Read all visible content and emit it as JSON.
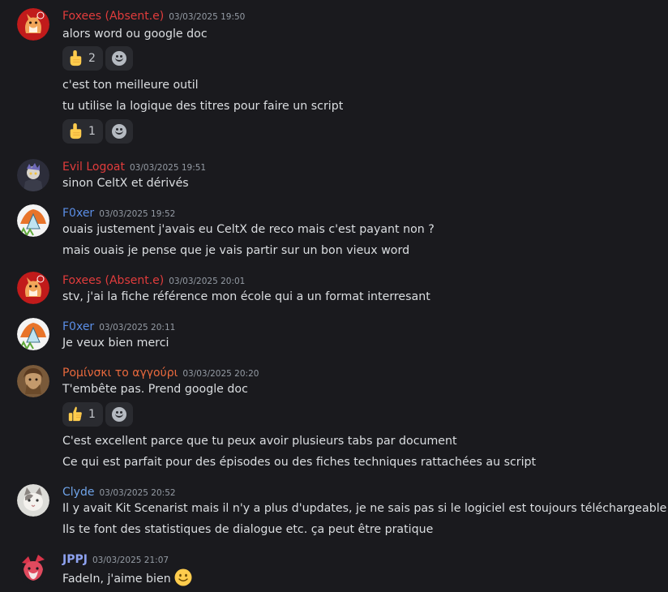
{
  "colors": {
    "background": "#1a1a1e",
    "text": "#dbdee1",
    "timestamp": "#949ba4",
    "red_name": "#e13c3c",
    "blue_name": "#5b8ee6",
    "orange_name": "#e8693d",
    "light_blue_name": "#6fa3e8",
    "purple_name": "#8ea2f0"
  },
  "messages": [
    {
      "author": "Foxees (Absent.e)",
      "timestamp": "03/03/2025 19:50",
      "lines": [
        "alors word ou google doc"
      ],
      "reaction": {
        "emoji": "pointing-up-hand",
        "count": "2"
      },
      "continuation": [
        "c'est ton meilleure outil",
        "tu utilise la logique des titres pour faire un script"
      ],
      "reaction2": {
        "emoji": "pointing-up-hand",
        "count": "1"
      }
    },
    {
      "author": "Evil Logoat",
      "timestamp": "03/03/2025 19:51",
      "lines": [
        "sinon CeltX et dérivés"
      ]
    },
    {
      "author": "F0xer",
      "timestamp": "03/03/2025 19:52",
      "lines": [
        "ouais justement j'avais eu CeltX de reco mais c'est payant non ?",
        "mais ouais je pense que je vais partir sur un bon vieux word"
      ]
    },
    {
      "author": "Foxees (Absent.e)",
      "timestamp": "03/03/2025 20:01",
      "lines": [
        "stv, j'ai la fiche référence mon école qui a un format interresant"
      ]
    },
    {
      "author": "F0xer",
      "timestamp": "03/03/2025 20:11",
      "lines": [
        "Je veux bien merci"
      ]
    },
    {
      "author": "Ρομίνσκι το αγγούρι",
      "timestamp": "03/03/2025 20:20",
      "lines": [
        "T'embête pas. Prend google doc"
      ],
      "reaction": {
        "emoji": "thumbs-up",
        "count": "1"
      },
      "continuation": [
        "C'est excellent parce que tu peux avoir plusieurs tabs par document",
        "Ce qui est parfait pour des épisodes ou des fiches techniques rattachées au script"
      ]
    },
    {
      "author": "Clyde",
      "timestamp": "03/03/2025 20:52",
      "lines": [
        "Il y avait Kit Scenarist mais il n'y a plus d'updates, je ne sais pas si le logiciel est toujours téléchargeable",
        "Ils te font des statistiques de dialogue etc. ça peut être pratique"
      ]
    },
    {
      "author": "JPPJ",
      "timestamp": "03/03/2025 21:07",
      "lines": [
        "FadeIn, j'aime bien"
      ],
      "inline_emoji": "slightly-smiling-face"
    }
  ]
}
